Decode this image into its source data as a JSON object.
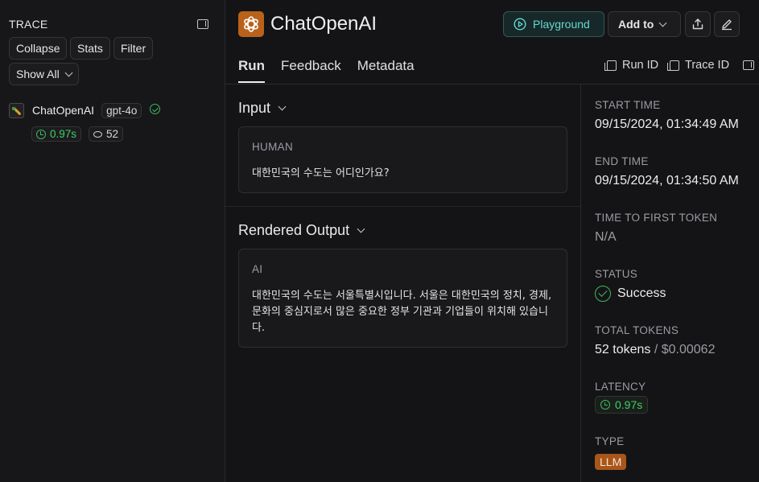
{
  "sidebar": {
    "title": "TRACE",
    "buttons": {
      "collapse": "Collapse",
      "stats": "Stats",
      "filter": "Filter",
      "show_all": "Show All"
    },
    "run": {
      "name": "ChatOpenAI",
      "model": "gpt-4o",
      "latency": "0.97s",
      "tokens": "52"
    }
  },
  "header": {
    "title": "ChatOpenAI",
    "playground_label": "Playground",
    "add_to_label": "Add to",
    "tabs": [
      "Run",
      "Feedback",
      "Metadata"
    ],
    "run_id_label": "Run ID",
    "trace_id_label": "Trace ID"
  },
  "input": {
    "title": "Input",
    "role": "HUMAN",
    "text": "대한민국의 수도는 어디인가요?"
  },
  "output": {
    "title": "Rendered Output",
    "role": "AI",
    "lines": [
      "대한민국의 수도는 서울특별시입니다. 서울은 대한민국의 정치, 경제,",
      "문화의 중심지로서 많은 중요한 정부 기관과 기업들이 위치해 있습니",
      "다."
    ]
  },
  "meta": {
    "start_time_label": "START TIME",
    "start_time": "09/15/2024, 01:34:49 AM",
    "end_time_label": "END TIME",
    "end_time": "09/15/2024, 01:34:50 AM",
    "ttft_label": "TIME TO FIRST TOKEN",
    "ttft": "N/A",
    "status_label": "STATUS",
    "status": "Success",
    "tokens_label": "TOTAL TOKENS",
    "tokens": "52 tokens",
    "cost": "/ $0.00062",
    "latency_label": "LATENCY",
    "latency": "0.97s",
    "type_label": "TYPE",
    "type": "LLM"
  },
  "colors": {
    "background": "#141416",
    "accent_teal": "#4fd1c5",
    "success_green": "#3fb760",
    "brand_orange": "#b8621b"
  },
  "icons": [
    "panel-toggle-icon",
    "chevron-down-icon",
    "llm-run-icon",
    "check-circle-icon",
    "clock-icon",
    "coins-icon",
    "openai-logo",
    "play-icon",
    "share-icon",
    "edit-icon",
    "copy-icon"
  ]
}
